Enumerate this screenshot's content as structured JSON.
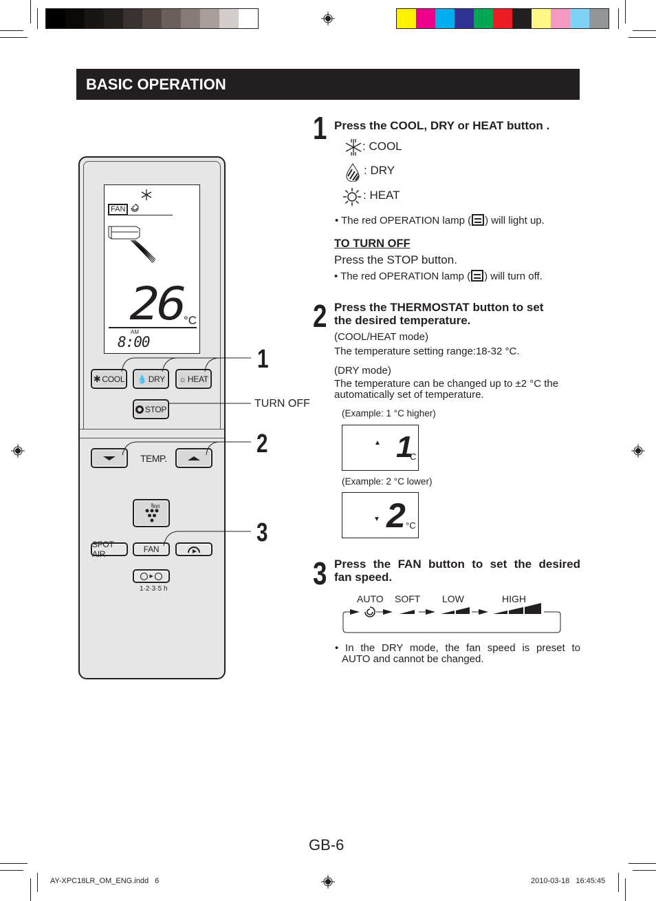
{
  "print_marks": {
    "grayscale_swatches": [
      "#000000",
      "#0b0908",
      "#181514",
      "#231f1e",
      "#3a3230",
      "#4f4642",
      "#6b605b",
      "#877c77",
      "#a89f9c",
      "#d3cdcb",
      "#ffffff"
    ],
    "color_swatches": [
      "#fff200",
      "#ec008c",
      "#00aeef",
      "#2e3192",
      "#00a651",
      "#ed1c24",
      "#231f20",
      "#fff685",
      "#f49ac1",
      "#7fd3f7",
      "#939598"
    ]
  },
  "header": {
    "title": "BASIC OPERATION"
  },
  "remote": {
    "lcd": {
      "fan_label": "FAN",
      "temperature": "26",
      "temp_unit": "°C",
      "am_label": "AM",
      "clock": "8:00"
    },
    "buttons": {
      "cool": "COOL",
      "dry": "DRY",
      "heat": "HEAT",
      "stop": "STOP",
      "temp_label": "TEMP.",
      "ion_label": "Ion",
      "spot_air": "SPOT AIR",
      "fan": "FAN",
      "timer_label": "1·2·3·5 h"
    },
    "callouts": {
      "one": "1",
      "turn_off": "TURN OFF",
      "two": "2",
      "three": "3"
    }
  },
  "steps": [
    {
      "number": "1",
      "title": "Press the COOL, DRY or HEAT button .",
      "modes": [
        {
          "icon": "snowflake-icon",
          "label": ": COOL"
        },
        {
          "icon": "droplet-icon",
          "label": ": DRY"
        },
        {
          "icon": "sun-icon",
          "label": ": HEAT"
        }
      ],
      "note_before": "• The red OPERATION lamp (",
      "note_after": ") will light up.",
      "turn_off_heading": "TO TURN OFF",
      "turn_off_text": "Press the STOP button.",
      "turn_off_note_before": "• The red OPERATION lamp (",
      "turn_off_note_after": ") will turn off."
    },
    {
      "number": "2",
      "title_line1": "Press the THERMOSTAT button to set",
      "title_line2": "the desired temperature.",
      "cool_heat_mode": "(COOL/HEAT mode)",
      "range_text": "The temperature setting range:18-32 °C.",
      "dry_mode": "(DRY mode)",
      "dry_text_line1": "The temperature can be changed up to ±2 °C the",
      "dry_text_line2": "automatically set of temperature.",
      "example1_caption": "(Example: 1 °C higher)",
      "example1_value": "1",
      "example2_caption": "(Example: 2 °C lower)",
      "example2_value": "2",
      "unit": "°C"
    },
    {
      "number": "3",
      "title_line1": "Press the FAN button to set the desired",
      "title_line2": "fan speed.",
      "fan_speeds": [
        "AUTO",
        "SOFT",
        "LOW",
        "HIGH"
      ],
      "note_line1": "• In the DRY mode, the fan speed is preset to",
      "note_line2": "AUTO and cannot be changed."
    }
  ],
  "footer": {
    "page_number": "GB-6",
    "file_name": "AY-XPC18LR_OM_ENG.indd   6",
    "timestamp": "2010-03-18   16:45:45"
  }
}
